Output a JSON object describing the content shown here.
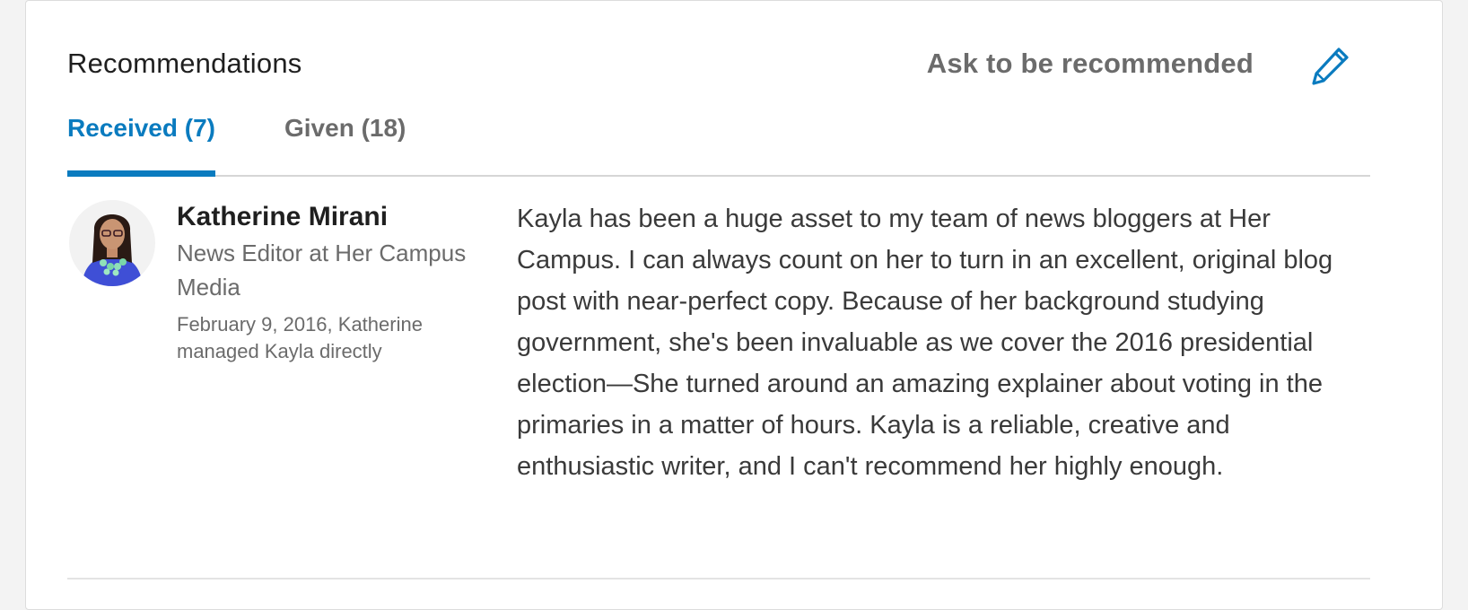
{
  "section": {
    "title": "Recommendations",
    "ask_link": "Ask to be recommended",
    "edit_icon": "pencil-icon"
  },
  "tabs": [
    {
      "label": "Received (7)",
      "active": true
    },
    {
      "label": "Given (18)",
      "active": false
    }
  ],
  "recommendation": {
    "name": "Katherine Mirani",
    "headline": "News Editor at Her Campus Media",
    "meta": "February 9, 2016, Katherine managed Kayla directly",
    "text": "Kayla has been a huge asset to my team of news bloggers at Her Campus. I can always count on her to turn in an excellent, original blog post with near-perfect copy. Because of her background studying government, she's been invaluable as we cover the 2016 presidential election—She turned around an amazing explainer about voting in the primaries in a matter of hours. Kayla is a reliable, creative and enthusiastic writer, and I can't recommend her highly enough."
  },
  "colors": {
    "accent": "#0a7bbf",
    "muted_text": "#6b6b6b",
    "body_text": "#3a3a3a",
    "background": "#f3f3f3"
  }
}
